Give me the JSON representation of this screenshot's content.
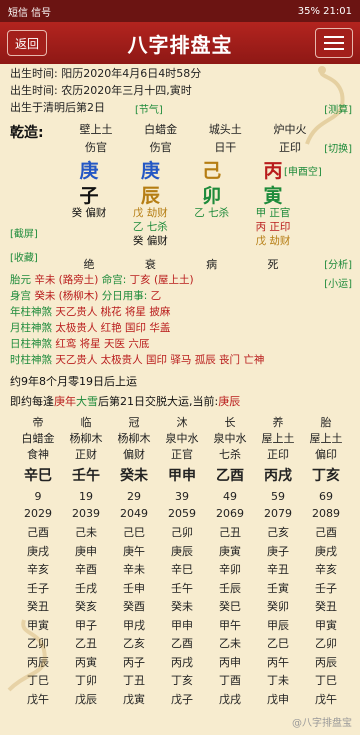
{
  "status": {
    "left": "短信 信号",
    "right": "35%  21:01"
  },
  "header": {
    "back": "返回",
    "title": "八字排盘宝"
  },
  "birth": {
    "solar": "出生时间: 阳历2020年4月6日4时58分",
    "lunar": "出生时间: 农历2020年三月十四,寅时",
    "jie": "出生于清明后第2日",
    "tag_jieqi": "[节气]",
    "tag_cesuan": "[测算]"
  },
  "pillars": {
    "label": "乾造:",
    "gods_top": [
      "壁上土",
      "白蜡金",
      "城头土",
      "炉中火"
    ],
    "relation": [
      "伤官",
      "伤官",
      "日干",
      "正印"
    ],
    "stems": [
      "庚",
      "庚",
      "己",
      "丙"
    ],
    "kong": "[申酉空]",
    "branches": [
      "子",
      "辰",
      "卯",
      "寅"
    ],
    "hidden": [
      [
        "癸 偏财"
      ],
      [
        "戊 劫财",
        "乙 七杀",
        "癸 偏财"
      ],
      [
        "乙 七杀"
      ],
      [
        "甲 正官",
        "丙 正印",
        "戊 劫财"
      ]
    ],
    "states": [
      "绝",
      "衰",
      "病",
      "死"
    ],
    "switch": "[切换]",
    "jie": "[截屏]",
    "shou": "[收藏]",
    "fenxi": "[分析]",
    "xiaoyun": "[小运]"
  },
  "extra": [
    {
      "k": "胎元",
      "v": "辛未 (路旁土)",
      "k2": "命宫:",
      "v2": "丁亥 (屋上土)"
    },
    {
      "k": "身宫",
      "v": "癸未 (杨柳木)",
      "k2": "分日用事:",
      "v2": "乙"
    },
    {
      "k": "年柱神煞",
      "v": "天乙贵人 桃花 将星 披麻"
    },
    {
      "k": "月柱神煞",
      "v": "太极贵人 红艳 国印 华盖"
    },
    {
      "k": "日柱神煞",
      "v": "红鸾 将星 天医 六厎"
    },
    {
      "k": "时柱神煞",
      "v": "天乙贵人 太极贵人 国印 驿马 孤辰 丧门 亡神"
    }
  ],
  "yun": {
    "line1": "约9年8个月零19日后上运",
    "line2a": "即约每逢",
    "line2b": "庚年",
    "line2c": "大雪",
    "line2d": "后第21日交脱大运,当前:",
    "line2e": "庚辰"
  },
  "dayun": {
    "state": [
      "帝",
      "临",
      "冠",
      "沐",
      "长",
      "养",
      "胎"
    ],
    "nayin": [
      "白蜡金",
      "杨柳木",
      "杨柳木",
      "泉中水",
      "泉中水",
      "屋上土",
      "屋上土"
    ],
    "god": [
      "食神",
      "正财",
      "偏财",
      "正官",
      "七杀",
      "正印",
      "偏印"
    ],
    "gz": [
      "辛巳",
      "壬午",
      "癸未",
      "甲申",
      "乙酉",
      "丙戌",
      "丁亥"
    ],
    "age": [
      "9",
      "19",
      "29",
      "39",
      "49",
      "59",
      "69"
    ],
    "year": [
      "2029",
      "2039",
      "2049",
      "2059",
      "2069",
      "2079",
      "2089"
    ],
    "liunian": [
      [
        "己酉",
        "己未",
        "己巳",
        "己卯",
        "己丑",
        "己亥",
        "己酉"
      ],
      [
        "庚戌",
        "庚申",
        "庚午",
        "庚辰",
        "庚寅",
        "庚子",
        "庚戌"
      ],
      [
        "辛亥",
        "辛酉",
        "辛未",
        "辛巳",
        "辛卯",
        "辛丑",
        "辛亥"
      ],
      [
        "壬子",
        "壬戌",
        "壬申",
        "壬午",
        "壬辰",
        "壬寅",
        "壬子"
      ],
      [
        "癸丑",
        "癸亥",
        "癸酉",
        "癸未",
        "癸巳",
        "癸卯",
        "癸丑"
      ],
      [
        "甲寅",
        "甲子",
        "甲戌",
        "甲申",
        "甲午",
        "甲辰",
        "甲寅"
      ],
      [
        "乙卯",
        "乙丑",
        "乙亥",
        "乙酉",
        "乙未",
        "乙巳",
        "乙卯"
      ],
      [
        "丙辰",
        "丙寅",
        "丙子",
        "丙戌",
        "丙申",
        "丙午",
        "丙辰"
      ],
      [
        "丁巳",
        "丁卯",
        "丁丑",
        "丁亥",
        "丁酉",
        "丁未",
        "丁巳"
      ],
      [
        "戊午",
        "戊辰",
        "戊寅",
        "戊子",
        "戊戌",
        "戊申",
        "戊午"
      ]
    ]
  },
  "watermark": "@八字排盘宝"
}
